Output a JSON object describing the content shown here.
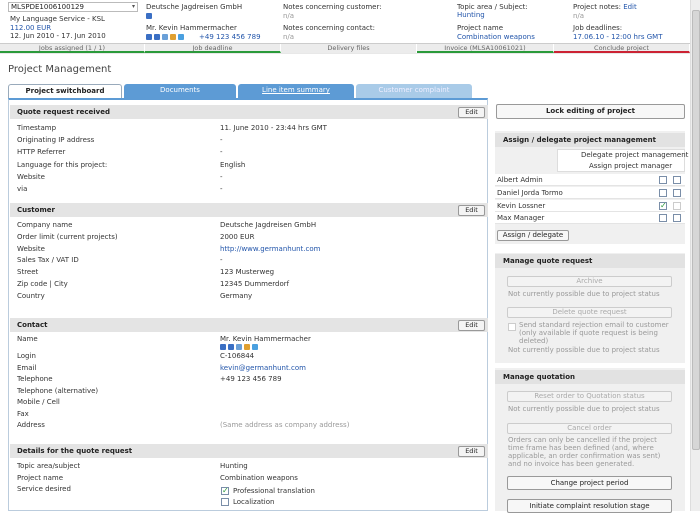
{
  "header": {
    "job_id": "MLSPDE1006100129",
    "service": "My Language Service - KSL",
    "price": "112.00 EUR",
    "dates": "12. Jun 2010 - 17. Jun 2010",
    "company": "Deutsche Jagdreisen GmbH",
    "contact_name": "Mr. Kevin Hammermacher",
    "contact_phone": "+49 123 456 789",
    "notes_customer_label": "Notes concerning customer:",
    "notes_customer_value": "n/a",
    "notes_contact_label": "Notes concerning contact:",
    "notes_contact_value": "n/a",
    "topic_label": "Topic area / Subject:",
    "topic_value": "Hunting",
    "project_name_label": "Project name",
    "project_name_value": "Combination weapons",
    "project_notes_label": "Project notes:",
    "project_notes_edit": "Edit",
    "project_notes_value": "n/a",
    "job_deadlines_label": "Job deadlines:",
    "job_deadlines_value": "17.06.10 - 12:00 hrs GMT"
  },
  "progress": [
    "Jobs assigned (1 / 1)",
    "Job deadline",
    "Delivery files",
    "Invoice (MLSA10061021)",
    "Conclude project"
  ],
  "page_title": "Project Management",
  "tabs": [
    "Project switchboard",
    "Documents",
    "Line item summary",
    "Customer complaint"
  ],
  "edit_label": "Edit",
  "quote_request": {
    "title": "Quote request received",
    "rows": [
      [
        "Timestamp",
        "11. June 2010 - 23:44 hrs GMT"
      ],
      [
        "Originating IP address",
        "-"
      ],
      [
        "HTTP Referrer",
        "-"
      ],
      [
        "Language for this project:",
        "English"
      ],
      [
        "Website",
        "-"
      ],
      [
        "via",
        "-"
      ]
    ]
  },
  "customer": {
    "title": "Customer",
    "rows": [
      [
        "Company name",
        "Deutsche Jagdreisen GmbH"
      ],
      [
        "Order limit (current projects)",
        "2000 EUR"
      ],
      [
        "Website",
        "http://www.germanhunt.com"
      ],
      [
        "Sales Tax / VAT ID",
        "-"
      ],
      [
        "Street",
        "123 Musterweg"
      ],
      [
        "Zip code | City",
        "12345 Dummerdorf"
      ],
      [
        "Country",
        "Germany"
      ]
    ]
  },
  "contact": {
    "title": "Contact",
    "name_label": "Name",
    "name_value": "Mr. Kevin Hammermacher",
    "rows": [
      [
        "Login",
        "C-106844"
      ],
      [
        "Email",
        "kevin@germanhunt.com"
      ],
      [
        "Telephone",
        "+49 123 456 789"
      ],
      [
        "Telephone (alternative)",
        ""
      ],
      [
        "Mobile / Cell",
        ""
      ],
      [
        "Fax",
        ""
      ],
      [
        "Address",
        "(Same address as company address)"
      ]
    ]
  },
  "details": {
    "title": "Details for the quote request",
    "rows": [
      [
        "Topic area/subject",
        "Hunting"
      ],
      [
        "Project name",
        "Combination weapons"
      ],
      [
        "Service desired",
        ""
      ]
    ],
    "service_options": [
      "Professional translation",
      "Localization"
    ]
  },
  "right": {
    "lock_button": "Lock editing of project",
    "assign_title": "Assign / delegate project management",
    "col_delegate": "Delegate project management",
    "col_assign": "Assign project manager",
    "people": [
      "Albert Admin",
      "Daniel Jorda Tormo",
      "Kevin Lossner",
      "Max Manager"
    ],
    "assign_button": "Assign / delegate",
    "manage_quote_request_title": "Manage quote request",
    "archive_button": "Archive",
    "archive_note": "Not currently possible due to project status",
    "delete_button": "Delete quote request",
    "rejection_checkbox": "Send standard rejection email to customer (only available if quote request is being deleted)",
    "delete_note": "Not currently possible due to project status",
    "manage_quotation_title": "Manage quotation",
    "reset_button": "Reset order to Quotation status",
    "reset_note": "Not currently possible due to project status",
    "cancel_button": "Cancel order",
    "cancel_note": "Orders can only be cancelled if the project time frame has been defined (and, where applicable, an order confirmation was sent) and no invoice has been generated.",
    "change_period_button": "Change project period",
    "complaint_button": "Initiate complaint resolution stage"
  },
  "colors": {
    "accent": "#5d9bd5",
    "link": "#2255aa",
    "success": "#2a9a3a",
    "danger": "#cc2233"
  }
}
